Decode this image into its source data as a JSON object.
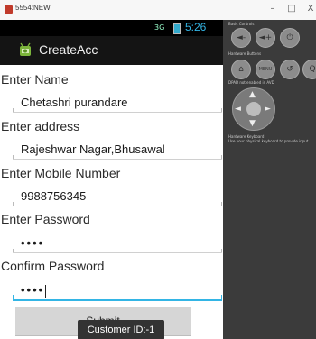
{
  "window": {
    "title": "5554:NEW",
    "minimize": "–",
    "maximize": "□",
    "close": "X"
  },
  "status_bar": {
    "signal": "3G",
    "time": "5:26"
  },
  "action_bar": {
    "app_title": "CreateAcc"
  },
  "form": {
    "name": {
      "label": "Enter Name",
      "value": "Chetashri purandare"
    },
    "address": {
      "label": "Enter address",
      "value": "Rajeshwar Nagar,Bhusawal"
    },
    "mobile": {
      "label": "Enter Mobile Number",
      "value": "9988756345"
    },
    "password": {
      "label": "Enter Password",
      "value": "••••"
    },
    "confirm": {
      "label": "Confirm Password",
      "value": "••••"
    }
  },
  "submit_label": "Submit",
  "toast": "Customer ID:-1",
  "controls": {
    "basic_label": "Basic Controls",
    "hardware_label": "Hardware Buttons",
    "dpad_label": "DPAD not enabled in AVD",
    "keyboard_label": "Hardware Keyboard",
    "keyboard_hint": "Use your physical keyboard to provide input",
    "buttons": {
      "vol_down": "◄-",
      "vol_up": "◄+",
      "power": "⏻",
      "home": "⌂",
      "menu": "MENU",
      "back": "↺",
      "search": "Q"
    },
    "dpad_arrows": {
      "up": "▲",
      "down": "▼",
      "left": "◄",
      "right": "►"
    }
  }
}
